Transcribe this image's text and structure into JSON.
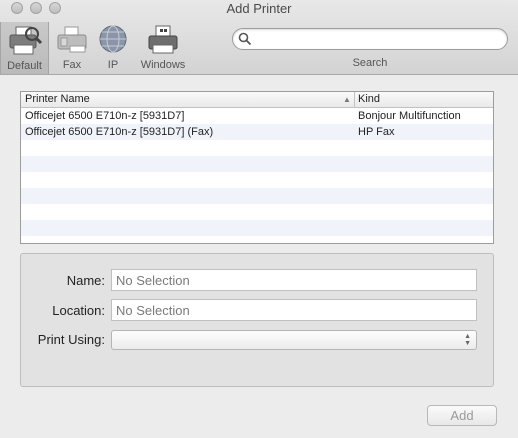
{
  "window": {
    "title": "Add Printer"
  },
  "toolbar": {
    "items": [
      {
        "label": "Default",
        "icon": "printer-icon",
        "selected": true
      },
      {
        "label": "Fax",
        "icon": "fax-icon"
      },
      {
        "label": "IP",
        "icon": "globe-icon"
      },
      {
        "label": "Windows",
        "icon": "windows-printer-icon"
      }
    ],
    "search": {
      "value": "",
      "placeholder": "",
      "label": "Search"
    }
  },
  "printer_list": {
    "columns": [
      "Printer Name",
      "Kind"
    ],
    "rows": [
      {
        "name": "Officejet 6500 E710n-z [5931D7]",
        "kind": "Bonjour Multifunction"
      },
      {
        "name": "Officejet 6500 E710n-z [5931D7] (Fax)",
        "kind": "HP Fax"
      }
    ]
  },
  "details": {
    "name_label": "Name:",
    "name_value": "No Selection",
    "location_label": "Location:",
    "location_value": "No Selection",
    "print_using_label": "Print Using:",
    "print_using_value": ""
  },
  "add_button": {
    "label": "Add"
  }
}
